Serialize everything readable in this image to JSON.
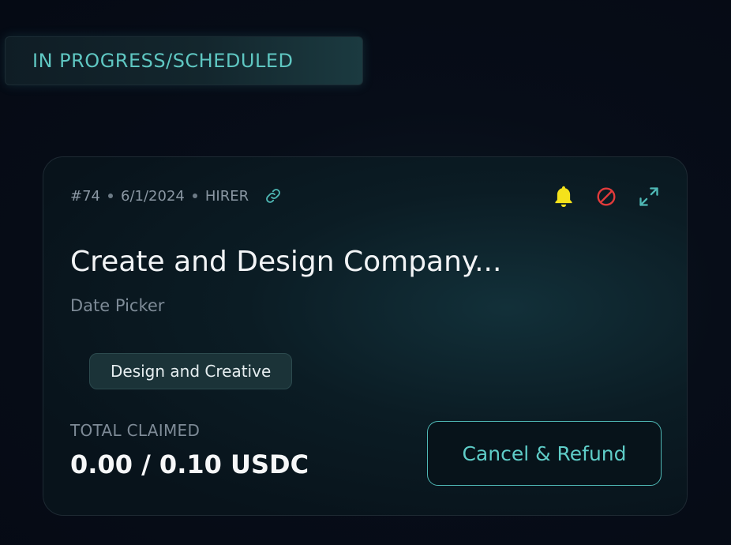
{
  "status_tab": {
    "label": "IN PROGRESS/SCHEDULED"
  },
  "card": {
    "id": "#74",
    "date": "6/1/2024",
    "role": "HIRER",
    "title": "Create and Design Company...",
    "subtitle": "Date Picker",
    "tag": "Design and Creative",
    "claimed_label": "TOTAL CLAIMED",
    "claimed_value": "0.00 / 0.10 USDC",
    "cancel_button_label": "Cancel & Refund",
    "icons": {
      "link": "link-icon",
      "notification": "bell-icon",
      "block": "block-icon",
      "expand": "expand-icon"
    }
  },
  "colors": {
    "accent": "#5fc7c2",
    "bell": "#f4e21b",
    "block": "#e23b3b",
    "background": "#060c17"
  }
}
